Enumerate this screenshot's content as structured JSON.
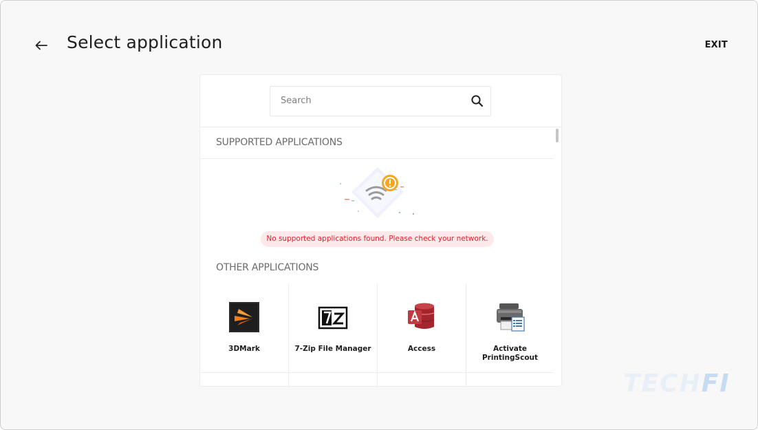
{
  "header": {
    "back_icon": "arrow-left-icon",
    "title": "Select application",
    "exit_label": "EXIT"
  },
  "search": {
    "placeholder": "Search",
    "value": "",
    "icon": "search-icon"
  },
  "supported_section": {
    "title": "SUPPORTED APPLICATIONS",
    "error_message": "No supported applications found. Please check your network.",
    "illustration_icon": "no-wifi-warning-icon"
  },
  "other_section": {
    "title": "OTHER APPLICATIONS",
    "apps": [
      {
        "label": "3DMark",
        "icon": "3dmark-icon"
      },
      {
        "label": "7-Zip File Manager",
        "icon": "7zip-icon"
      },
      {
        "label": "Access",
        "icon": "access-icon"
      },
      {
        "label": "Activate PrintingScout",
        "icon": "printer-icon"
      }
    ]
  },
  "colors": {
    "error_text": "#d8222d",
    "error_bg": "#fde9ea",
    "warning_orange": "#f5a623"
  },
  "watermark": {
    "text_a": "TECH",
    "text_b": "FI"
  }
}
